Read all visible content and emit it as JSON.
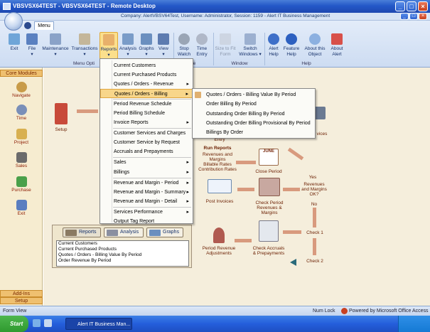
{
  "window": {
    "title": "VBSVSX64TEST - VBSVSX64TEST - Remote Desktop",
    "minimize": "_",
    "maximize": "□",
    "close": "×"
  },
  "app_title": {
    "left": "",
    "center": "Company: AlertVBSV64Test,  Username: Administrator,  Session: 1159  -  Alert IT Business Management"
  },
  "ribbon": {
    "tab": "Menu",
    "buttons": [
      {
        "id": "exit",
        "label": "Exit"
      },
      {
        "id": "file",
        "label": "File"
      },
      {
        "id": "maintenance",
        "label": "Maintenance"
      },
      {
        "id": "transactions",
        "label": "Transactions"
      },
      {
        "id": "reports",
        "label": "Reports"
      },
      {
        "id": "analysis",
        "label": "Analysis"
      },
      {
        "id": "graphs",
        "label": "Graphs"
      },
      {
        "id": "view",
        "label": "View"
      },
      {
        "id": "stopwatch",
        "label": "Stop Watch"
      },
      {
        "id": "timeentry",
        "label": "Time Entry"
      },
      {
        "id": "sizetofit",
        "label": "Size to Fit Form"
      },
      {
        "id": "switch",
        "label": "Switch Windows"
      },
      {
        "id": "alerthelp",
        "label": "Alert Help"
      },
      {
        "id": "featurehelp",
        "label": "Feature Help"
      },
      {
        "id": "about",
        "label": "About this Object"
      },
      {
        "id": "aboutalert",
        "label": "About Alert"
      }
    ],
    "groups": {
      "menu_options": "Menu Opti",
      "time": "ime",
      "window": "Window",
      "help": "Help"
    }
  },
  "sidebar": {
    "header": "Core Modules",
    "items": [
      "Navigate",
      "Time",
      "Project",
      "Sales",
      "Purchase",
      "Exit"
    ],
    "addins": "Add-Ins",
    "setup": "Setup"
  },
  "reports_menu": {
    "items": [
      {
        "label": "Current Customers",
        "sub": false
      },
      {
        "label": "Current Purchased Products",
        "sub": false
      },
      {
        "label": "Quotes / Orders - Revenue",
        "sub": true
      },
      {
        "label": "Quotes / Orders - Billing",
        "sub": true
      },
      {
        "label": "Period Revenue Schedule",
        "sub": false
      },
      {
        "label": "Period Billing Schedule",
        "sub": false
      },
      {
        "label": "Invoice Reports",
        "sub": true
      },
      {
        "label": "Customer Services and Charges",
        "sub": false
      },
      {
        "label": "Customer Service by Request",
        "sub": false
      },
      {
        "label": "Accruals and Prepayments",
        "sub": false
      },
      {
        "label": "Sales",
        "sub": true
      },
      {
        "label": "Billings",
        "sub": true
      },
      {
        "label": "Revenue and Margin - Period",
        "sub": true
      },
      {
        "label": "Revenue and Margin - Summary",
        "sub": true
      },
      {
        "label": "Revenue and Margin - Detail",
        "sub": true
      },
      {
        "label": "Services Performance",
        "sub": true
      },
      {
        "label": "Output Tag Report",
        "sub": false
      }
    ]
  },
  "billing_submenu": {
    "items": [
      "Quotes / Orders - Billing Value By Period",
      "Order Billing By Period",
      "Outstanding Order Billing By Period",
      "Outstanding Order Billing Provisional By Period",
      "Billings By Order"
    ]
  },
  "diagram": {
    "setup": "Setup",
    "entry": "Entry",
    "services": "vices",
    "run_reports": "Run Reports",
    "rr_lines": [
      "Revenues and",
      "Margins",
      "Billable Rates",
      "Contribution Rates"
    ],
    "close_period": "Close Period",
    "calendar_month": "JUNE",
    "yes": "Yes",
    "revenues_ok": [
      "Revenues",
      "and Margins",
      "OK?"
    ],
    "no": "No",
    "post_invoices": "Post Invoices",
    "check_period": [
      "Check Period",
      "Revenues &",
      "Margins"
    ],
    "check1": "Check 1",
    "period_revenue_adj": [
      "Period Revenue",
      "Adjustments"
    ],
    "check_accruals": [
      "Check Accruals",
      "& Prepayments"
    ],
    "check2": "Check 2"
  },
  "report_box": {
    "tabs": [
      "Reports",
      "Analysis",
      "Graphs"
    ],
    "list": [
      "Current Customers",
      "Current Purchased Products",
      "Quotes / Orders - Billing Value By Period",
      "Order Revenue By Period"
    ]
  },
  "status": {
    "left": "Form View",
    "numlock": "Num Lock",
    "office": "Powered by Microsoft Office Access"
  },
  "taskbar": {
    "start": "Start",
    "task": "Alert IT Business Man...",
    "clock": ""
  }
}
